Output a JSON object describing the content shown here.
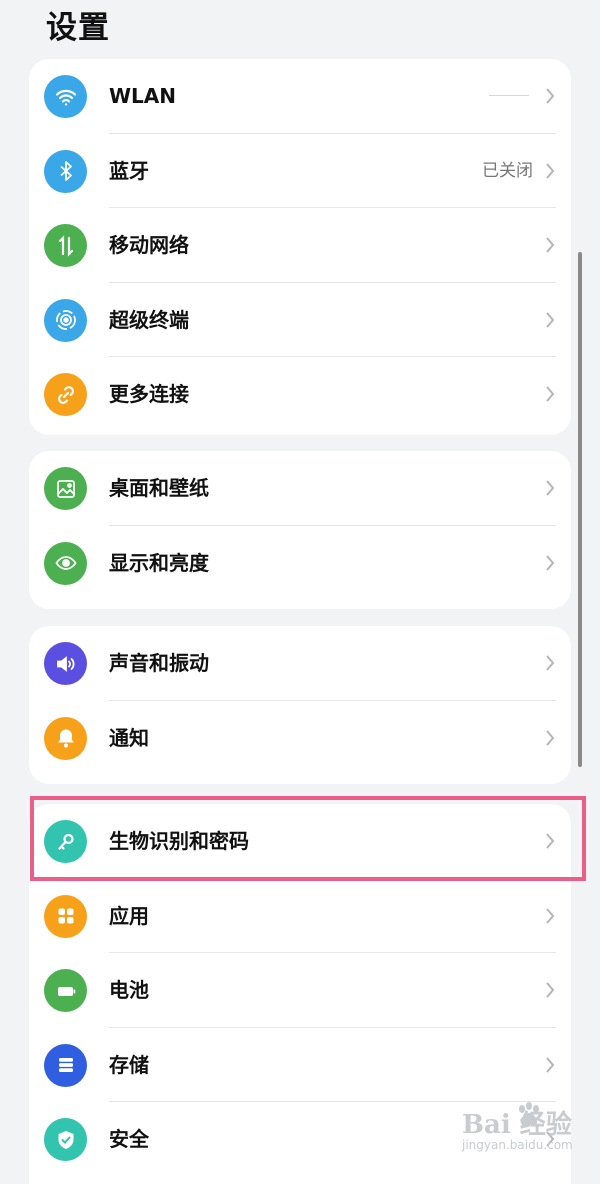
{
  "page": {
    "title": "设置"
  },
  "groups": [
    {
      "items": [
        {
          "label": "WLAN",
          "icon": "wifi-icon",
          "icon_color": "#3aa7e8"
        },
        {
          "label": "蓝牙",
          "value": "已关闭",
          "icon": "bluetooth-icon",
          "icon_color": "#3aa7e8"
        },
        {
          "label": "移动网络",
          "icon": "mobile-data-icon",
          "icon_color": "#4caf50"
        },
        {
          "label": "超级终端",
          "icon": "super-device-icon",
          "icon_color": "#3aa7e8"
        },
        {
          "label": "更多连接",
          "icon": "link-icon",
          "icon_color": "#f7a11a"
        }
      ]
    },
    {
      "items": [
        {
          "label": "桌面和壁纸",
          "icon": "wallpaper-icon",
          "icon_color": "#4caf50"
        },
        {
          "label": "显示和亮度",
          "icon": "eye-icon",
          "icon_color": "#4caf50"
        }
      ]
    },
    {
      "items": [
        {
          "label": "声音和振动",
          "icon": "speaker-icon",
          "icon_color": "#5a4fe0"
        },
        {
          "label": "通知",
          "icon": "bell-icon",
          "icon_color": "#f7a11a"
        }
      ]
    },
    {
      "items": [
        {
          "label": "生物识别和密码",
          "icon": "key-icon",
          "icon_color": "#33c4b0"
        },
        {
          "label": "应用",
          "icon": "apps-icon",
          "icon_color": "#f7a11a"
        },
        {
          "label": "电池",
          "icon": "battery-icon",
          "icon_color": "#4caf50"
        },
        {
          "label": "存储",
          "icon": "storage-icon",
          "icon_color": "#2f5fe0"
        },
        {
          "label": "安全",
          "icon": "shield-icon",
          "icon_color": "#33c4b0"
        }
      ]
    }
  ],
  "watermark": {
    "main": "Bai 经验",
    "sub": "jingyan.baidu.com"
  }
}
